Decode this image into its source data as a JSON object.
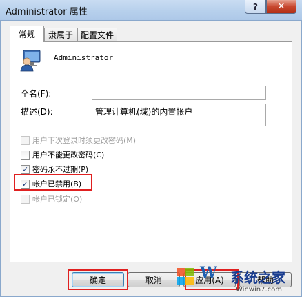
{
  "window": {
    "title": "Administrator 属性",
    "help_glyph": "?",
    "close_glyph": "✕"
  },
  "tabs": [
    {
      "label": "常规",
      "active": true
    },
    {
      "label": "隶属于",
      "active": false
    },
    {
      "label": "配置文件",
      "active": false
    }
  ],
  "user": {
    "icon": "user-account-icon",
    "name": "Administrator"
  },
  "form": {
    "fullname_label": "全名(F):",
    "fullname_value": "",
    "description_label": "描述(D):",
    "description_value": "管理计算机(域)的内置帐户"
  },
  "options": [
    {
      "label": "用户下次登录时须更改密码(M)",
      "checked": false,
      "disabled": true
    },
    {
      "label": "用户不能更改密码(C)",
      "checked": false,
      "disabled": false
    },
    {
      "label": "密码永不过期(P)",
      "checked": true,
      "disabled": false
    },
    {
      "label": "帐户已禁用(B)",
      "checked": true,
      "disabled": false
    },
    {
      "label": "帐户已锁定(O)",
      "checked": false,
      "disabled": true
    }
  ],
  "buttons": {
    "ok": "确定",
    "cancel": "取消",
    "apply": "应用(A)",
    "help": "帮助"
  },
  "watermark": {
    "logo_text": "W",
    "site_text": "系统之家",
    "url_text": "Winwin7.com"
  },
  "colors": {
    "highlight": "#e02020",
    "title_bar": "#b7d0ec",
    "close": "#c7472f"
  }
}
